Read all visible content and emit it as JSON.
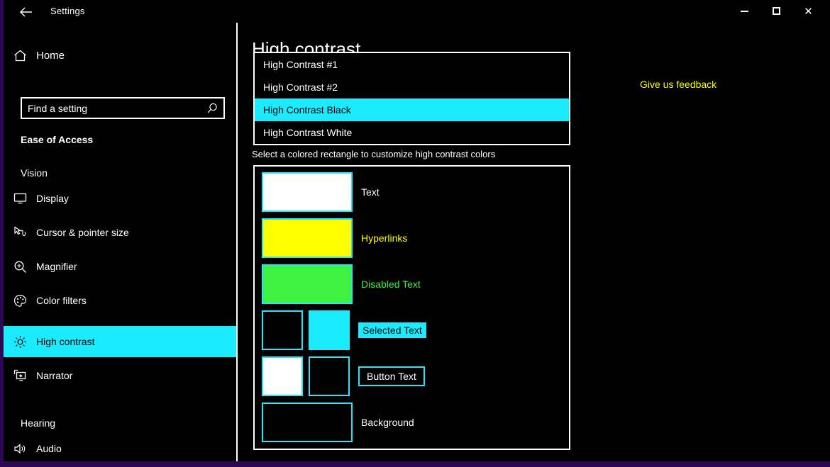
{
  "window": {
    "title": "Settings",
    "back_icon": "back-arrow-icon",
    "controls": {
      "minimize": "–",
      "maximize": "□",
      "close": "✕"
    },
    "frame_color": "#2E0854"
  },
  "sidebar": {
    "home": {
      "label": "Home",
      "icon": "home-icon"
    },
    "search": {
      "value": "",
      "placeholder": "Find a setting",
      "icon": "search-icon"
    },
    "section_header": "Ease of Access",
    "groups": [
      {
        "title": "Vision"
      },
      {
        "title": "Hearing"
      }
    ],
    "items": [
      {
        "label": "Display",
        "icon": "monitor-icon",
        "selected": false
      },
      {
        "label": "Cursor & pointer size",
        "icon": "cursor-pointer-icon",
        "selected": false
      },
      {
        "label": "Magnifier",
        "icon": "magnifier-icon",
        "selected": false
      },
      {
        "label": "Color filters",
        "icon": "palette-icon",
        "selected": false
      },
      {
        "label": "High contrast",
        "icon": "brightness-sun-icon",
        "selected": true
      },
      {
        "label": "Narrator",
        "icon": "narrator-icon",
        "selected": false
      },
      {
        "label": "Audio",
        "icon": "speaker-icon",
        "selected": false
      }
    ],
    "selected_bg": "#1AEBFF",
    "selected_fg": "#000000"
  },
  "main": {
    "page_title": "High contrast",
    "feedback_link": "Give us feedback",
    "helper_text": "Select a colored rectangle to customize high contrast colors"
  },
  "dropdown": {
    "open": true,
    "options": [
      {
        "label": "High Contrast #1",
        "selected": false
      },
      {
        "label": "High Contrast #2",
        "selected": false
      },
      {
        "label": "High Contrast Black",
        "selected": true
      },
      {
        "label": "High Contrast White",
        "selected": false
      }
    ],
    "selected_value": "High Contrast Black",
    "highlight_bg": "#1AEBFF",
    "highlight_fg": "#000000"
  },
  "color_panel": {
    "rows": [
      {
        "name": "Text",
        "label": "Text",
        "label_style": "plain",
        "label_color": "#FFFFFF",
        "swatches": [
          {
            "fill": "#FFFFFF",
            "size": "wide"
          }
        ]
      },
      {
        "name": "Hyperlinks",
        "label": "Hyperlinks",
        "label_style": "plain",
        "label_color": "#FFFF00",
        "swatches": [
          {
            "fill": "#FFFF00",
            "size": "wide"
          }
        ]
      },
      {
        "name": "Disabled Text",
        "label": "Disabled Text",
        "label_style": "plain",
        "label_color": "#3FF23F",
        "swatches": [
          {
            "fill": "#3FF23F",
            "size": "wide"
          }
        ]
      },
      {
        "name": "Selected Text",
        "label": "Selected Text",
        "label_style": "filled",
        "label_color": "#000000",
        "label_bg": "#1AEBFF",
        "swatches": [
          {
            "fill": "#000000",
            "size": "small"
          },
          {
            "fill": "#1AEBFF",
            "size": "small"
          }
        ]
      },
      {
        "name": "Button Text",
        "label": "Button Text",
        "label_style": "boxed",
        "label_color": "#FFFFFF",
        "swatches": [
          {
            "fill": "#FFFFFF",
            "size": "small"
          },
          {
            "fill": "#000000",
            "size": "small"
          }
        ]
      },
      {
        "name": "Background",
        "label": "Background",
        "label_style": "plain",
        "label_color": "#FFFFFF",
        "swatches": [
          {
            "fill": "#000000",
            "size": "wide"
          }
        ]
      }
    ],
    "swatch_border_color": "#1AEBFF"
  }
}
